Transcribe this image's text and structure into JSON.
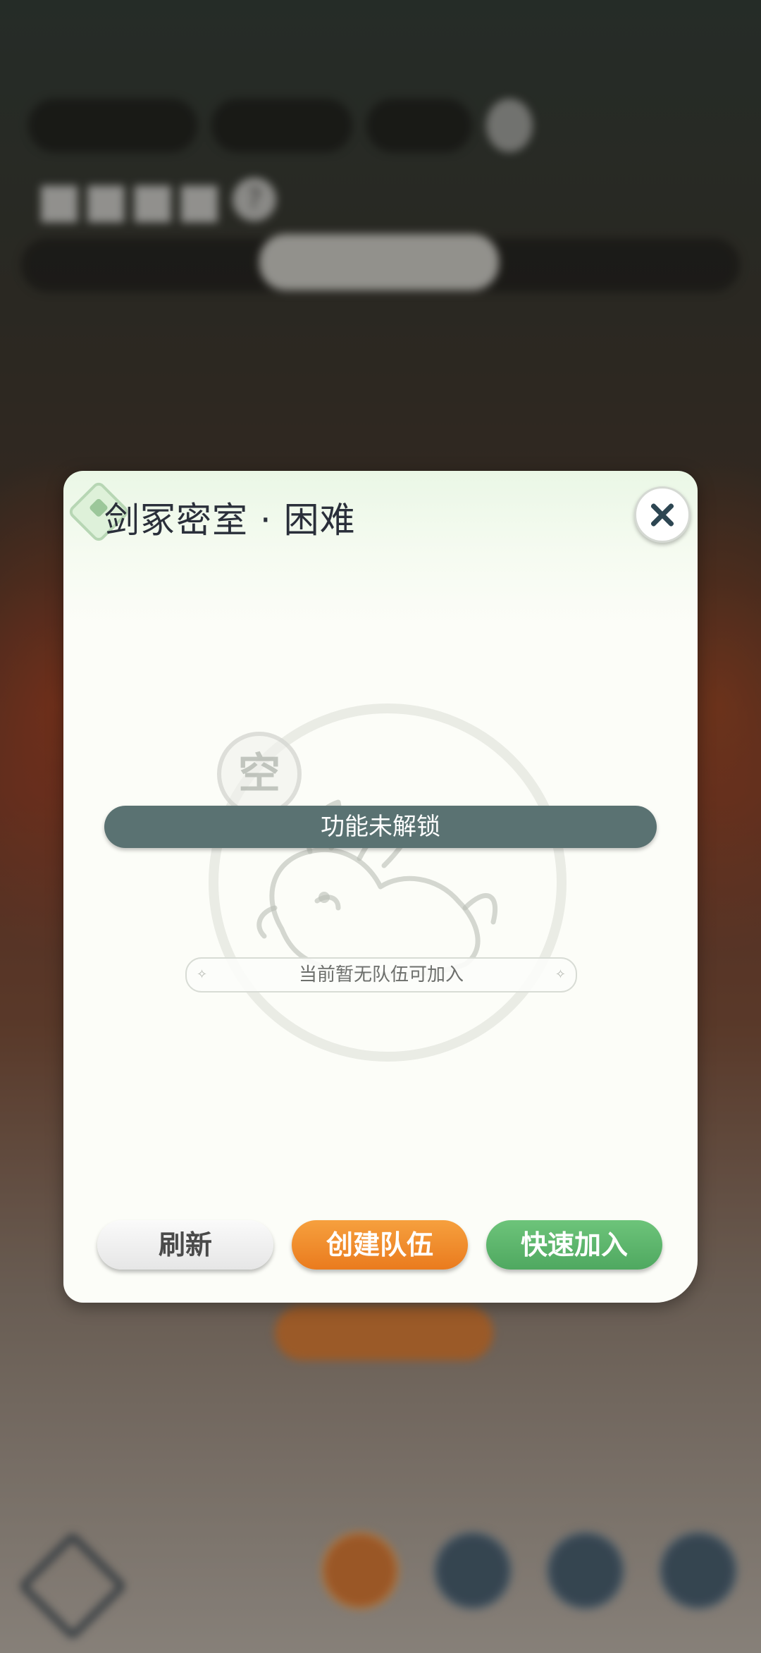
{
  "dialog": {
    "title": "剑冢密室 · 困难",
    "locked_message": "功能未解锁",
    "empty_badge": "空",
    "empty_text": "当前暂无队伍可加入",
    "buttons": {
      "refresh": "刷新",
      "create_team": "创建队伍",
      "quick_join": "快速加入"
    }
  },
  "colors": {
    "locked_bar": "#5a7272",
    "create_button": "#ea7b1e",
    "quick_join_button": "#4fa860",
    "close_icon": "#2d4652"
  },
  "icons": [
    "close-icon",
    "title-diamond-icon",
    "empty-mascot-icon",
    "help-icon"
  ]
}
